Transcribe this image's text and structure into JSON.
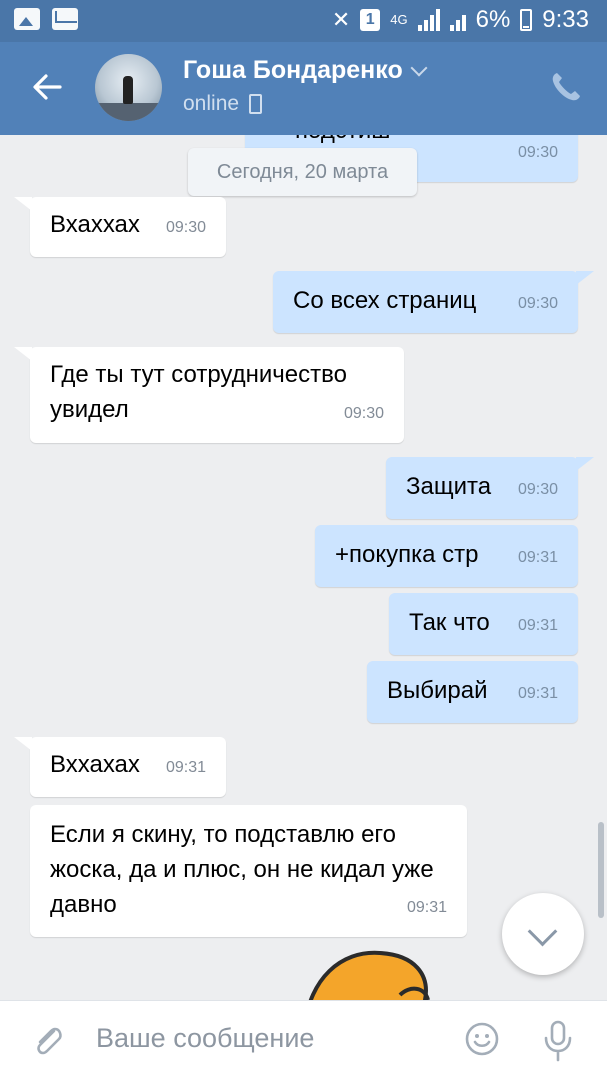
{
  "status_bar": {
    "signal_label": "4G",
    "battery": "6%",
    "time": "9:33",
    "notification_count": "1"
  },
  "header": {
    "name": "Гоша Бондаренко",
    "status": "online"
  },
  "date_separator": "Сегодня, 20 марта",
  "messages": [
    {
      "side": "out",
      "text": "подстиш",
      "time": "09:30"
    },
    {
      "side": "in",
      "text": "Вхаххах",
      "time": "09:30"
    },
    {
      "side": "out",
      "text": "Со всех страниц",
      "time": "09:30"
    },
    {
      "side": "in",
      "text": "Где ты тут сотрудничество увидел",
      "time": "09:30"
    },
    {
      "side": "out",
      "text": "Защита",
      "time": "09:30"
    },
    {
      "side": "out",
      "text": "+покупка стр",
      "time": "09:31"
    },
    {
      "side": "out",
      "text": "Так что",
      "time": "09:31"
    },
    {
      "side": "out",
      "text": "Выбирай",
      "time": "09:31"
    },
    {
      "side": "in",
      "text": "Вххахах",
      "time": "09:31"
    },
    {
      "side": "in",
      "text": "Если я скину,  то подставлю его жоска, да и плюс, он не кидал уже давно",
      "time": "09:31"
    }
  ],
  "composer": {
    "placeholder": "Ваше сообщение"
  },
  "colors": {
    "header": "#5181b8",
    "statusbar": "#4a76a8",
    "bubble_in": "#ffffff",
    "bubble_out": "#cce4ff",
    "chat_bg": "#edeef0"
  }
}
